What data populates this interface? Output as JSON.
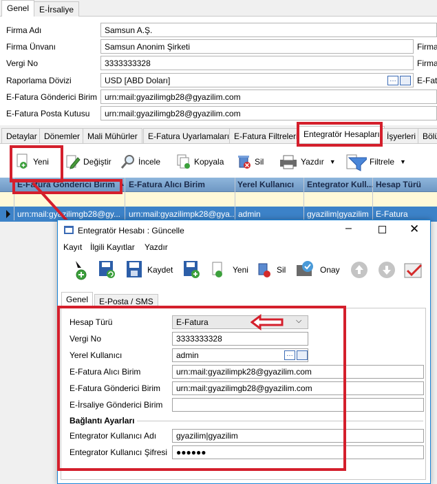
{
  "top_tabs": [
    "Genel",
    "E-İrsaliye"
  ],
  "form": {
    "labels": [
      "Firma Adı",
      "Firma Ünvanı",
      "Vergi No",
      "Raporlama Dövizi",
      "E-Fatura Gönderici Birim",
      "E-Fatura Posta Kutusu"
    ],
    "values": [
      "Samsun A.Ş.",
      "Samsun Anonim Şirketi",
      "3333333328",
      "USD [ABD Doları]",
      "urn:mail:gyazilimgb28@gyazilim.com",
      "urn:mail:gyazilimgb28@gyazilim.com"
    ],
    "right_labels": [
      "Firma",
      "Firma",
      "E-Fatu"
    ]
  },
  "bottom_tabs": [
    "Detaylar",
    "Dönemler",
    "Mali Mühürler",
    "E-Fatura Uyarlamaları",
    "E-Fatura Filtreleri",
    "Entegratör Hesapları",
    "İşyerleri",
    "Bölü"
  ],
  "toolbar": [
    "Yeni",
    "Değiştir",
    "İncele",
    "Kopyala",
    "Sil",
    "Yazdır",
    "Filtrele"
  ],
  "grid": {
    "headers": [
      "E-Fatura Gönderici Birim",
      "E-Fatura Alıcı Birim",
      "Yerel Kullanıcı",
      "Entegrator Kull...",
      "Hesap Türü"
    ],
    "row": [
      "urn:mail:gyazilimgb28@gy...",
      "urn:mail:gyazilimpk28@gya...",
      "admin",
      "gyazilim|gyazilim",
      "E-Fatura"
    ]
  },
  "dialog": {
    "title": "Entegratör Hesabı : Güncelle",
    "menu": [
      "Kayıt",
      "İlgili Kayıtlar",
      "Yazdır"
    ],
    "toolbar": [
      "Kaydet",
      "Yeni",
      "Sil",
      "Onay"
    ],
    "tabs": [
      "Genel",
      "E-Posta / SMS"
    ],
    "fields": {
      "labels": [
        "Hesap Türü",
        "Vergi No",
        "Yerel Kullanıcı",
        "E-Fatura Alıcı Birim",
        "E-Fatura Gönderici Birim",
        "E-İrsaliye Gönderici Birim"
      ],
      "values": [
        "E-Fatura",
        "3333333328",
        "admin",
        "urn:mail:gyazilimpk28@gyazilim.com",
        "urn:mail:gyazilimgb28@gyazilim.com",
        ""
      ]
    },
    "section": "Bağlantı Ayarları",
    "conn_labels": [
      "Entegrator Kullanıcı Adı",
      "Entegrator Kullanıcı Şifresi"
    ],
    "conn_values": [
      "gyazilim|gyazilim",
      "●●●●●●"
    ]
  },
  "colors": {
    "highlight": "#d41f2c",
    "selected_row": "#3c82c8",
    "header": "#7fa7d0"
  }
}
